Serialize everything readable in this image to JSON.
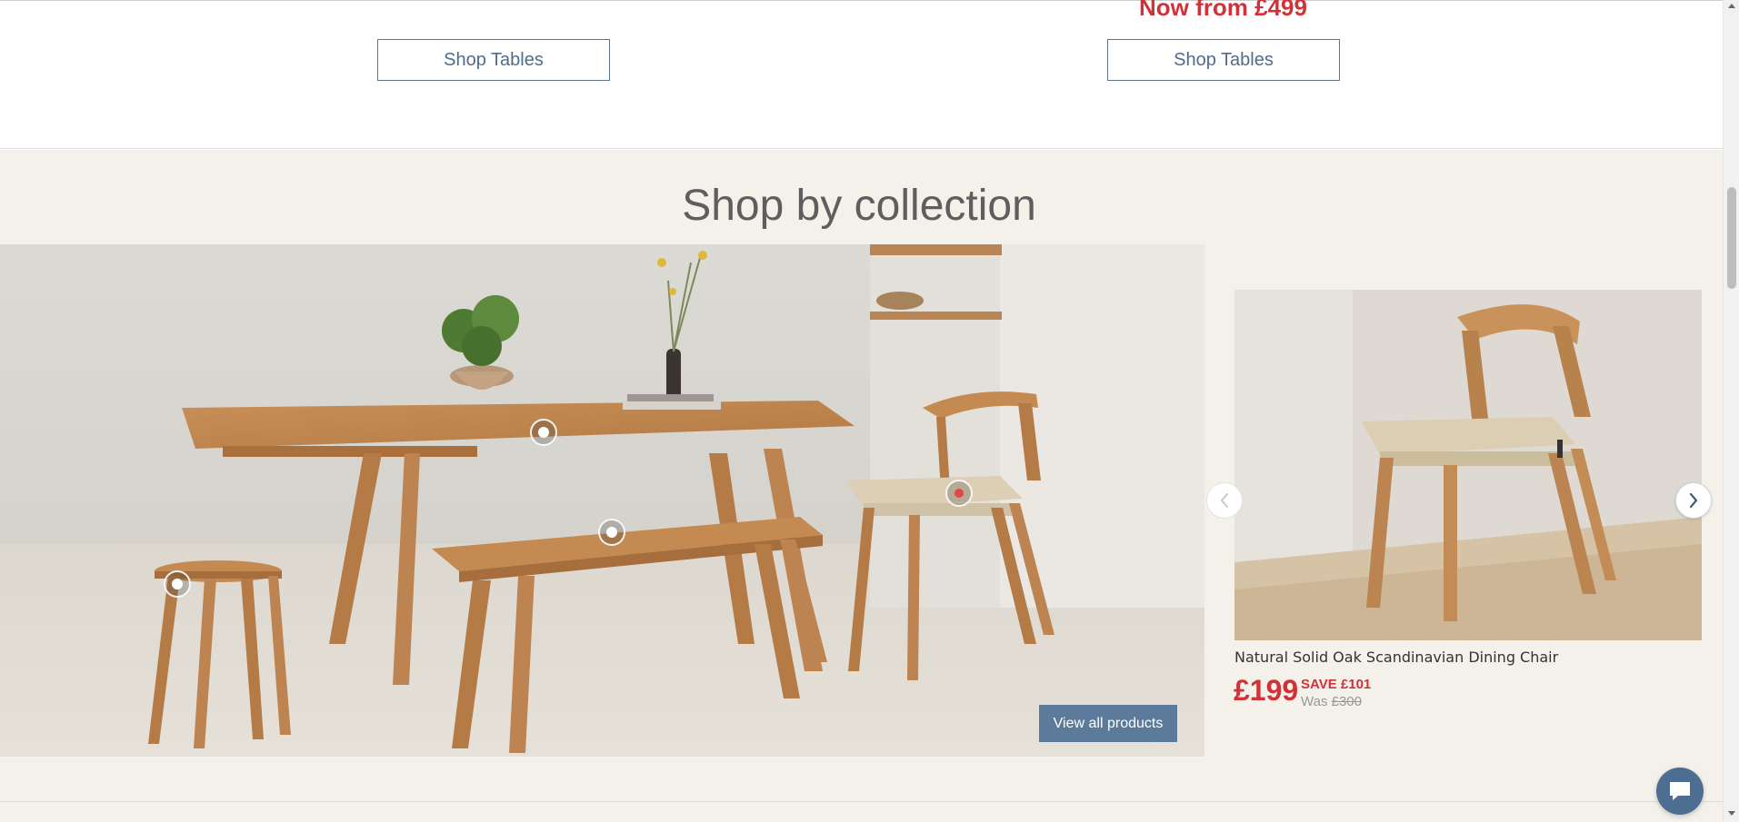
{
  "promo": {
    "price_text": "Now from £499",
    "buttons": [
      "Shop Tables",
      "Shop Tables"
    ]
  },
  "collection": {
    "title": "Shop by collection",
    "view_all_label": "View all products"
  },
  "product": {
    "name": "Natural Solid Oak Scandinavian Dining Chair",
    "price": "£199",
    "save": "SAVE £101",
    "was_label": "Was",
    "was_price": "£300"
  },
  "hotspots": [
    {
      "product": "table",
      "active": false
    },
    {
      "product": "bench",
      "active": false
    },
    {
      "product": "stool",
      "active": false
    },
    {
      "product": "chair",
      "active": true
    }
  ],
  "colors": {
    "sale_red": "#d03238",
    "brand_blue": "#5c7b9b",
    "section_bg": "#f4f1eb"
  },
  "icons": [
    "chevron-left-icon",
    "chevron-right-icon",
    "chat-icon",
    "scroll-up-icon",
    "scroll-down-icon"
  ]
}
